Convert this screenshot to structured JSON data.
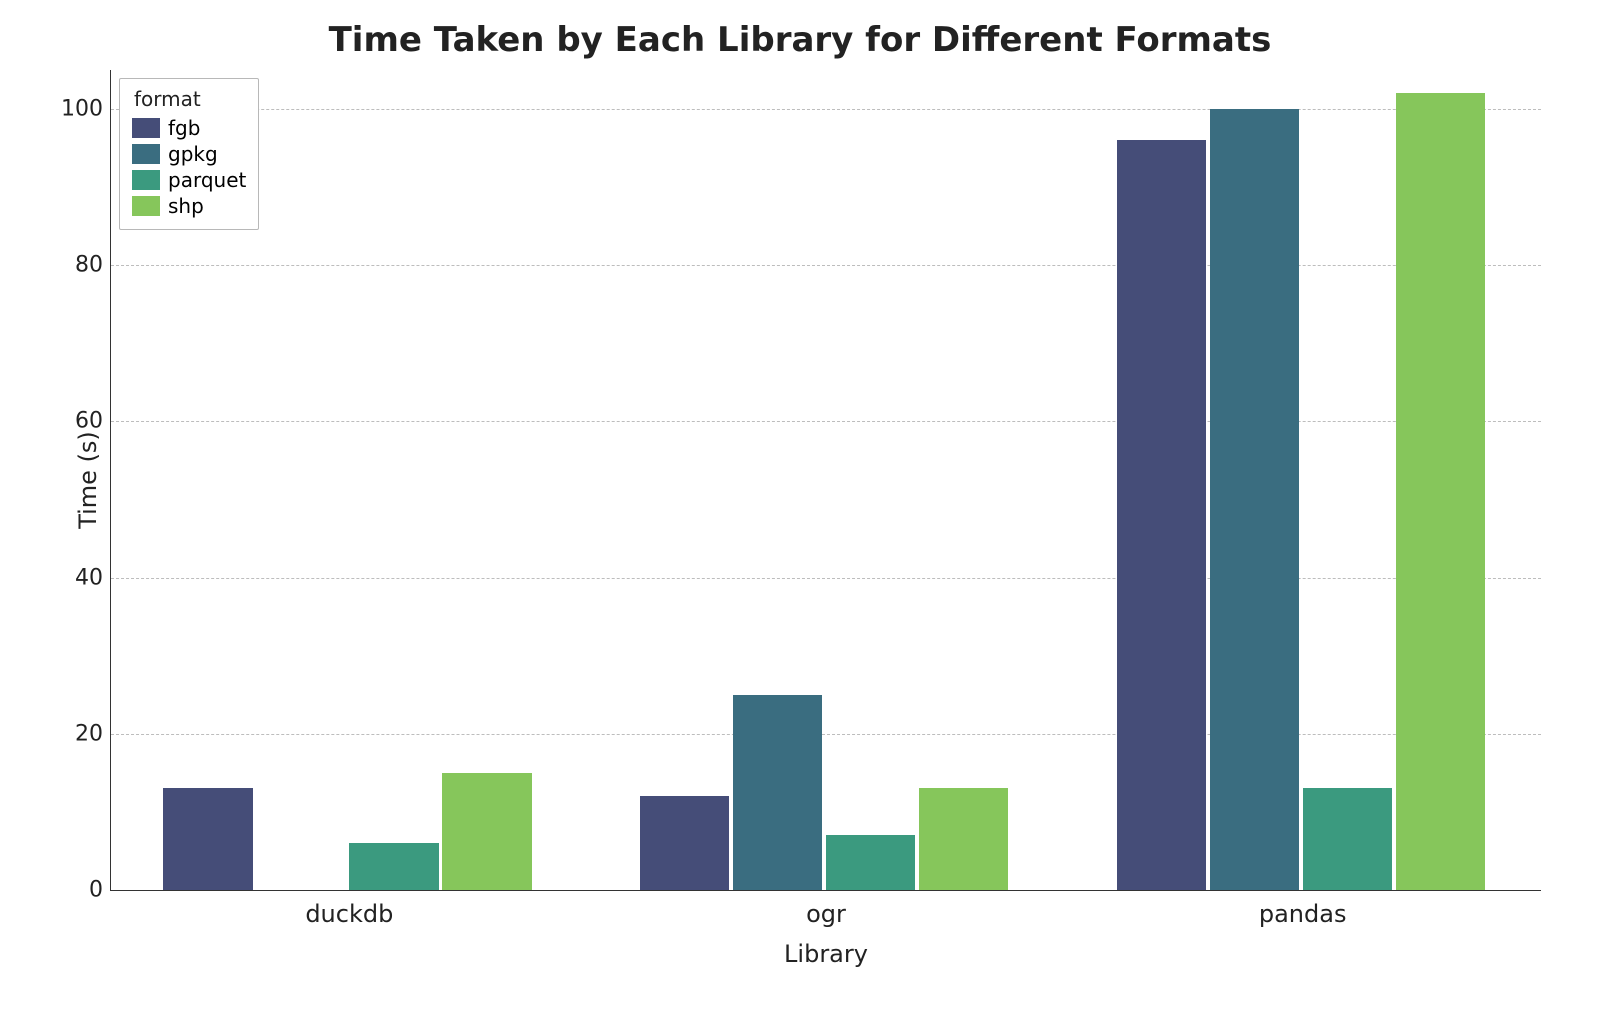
{
  "chart_data": {
    "type": "bar",
    "title": "Time Taken by Each Library for Different Formats",
    "xlabel": "Library",
    "ylabel": "Time (s)",
    "ylim": [
      0,
      105
    ],
    "yticks": [
      0,
      20,
      40,
      60,
      80,
      100
    ],
    "categories": [
      "duckdb",
      "ogr",
      "pandas"
    ],
    "series": [
      {
        "name": "fgb",
        "color": "#454d78",
        "values": [
          13,
          12,
          96
        ]
      },
      {
        "name": "gpkg",
        "color": "#3a6d80",
        "values": [
          0,
          25,
          100
        ]
      },
      {
        "name": "parquet",
        "color": "#3b9a7f",
        "values": [
          6,
          7,
          13
        ]
      },
      {
        "name": "shp",
        "color": "#86c65b",
        "values": [
          15,
          13,
          102
        ]
      }
    ],
    "legend_title": "format",
    "legend_position": "upper left"
  }
}
